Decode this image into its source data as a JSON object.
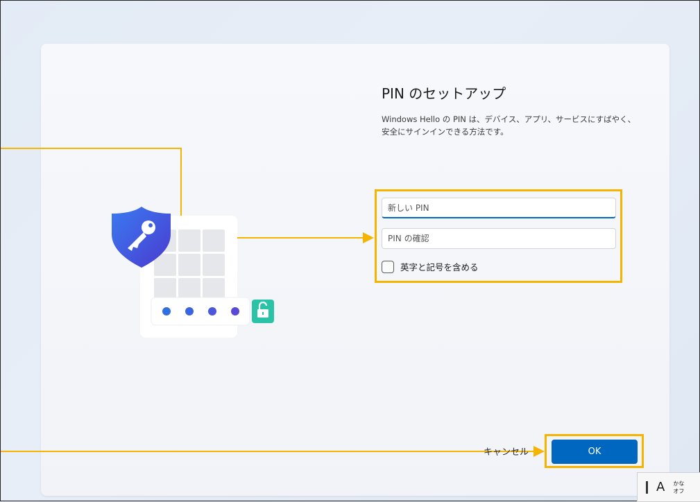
{
  "dialog": {
    "title": "PIN のセットアップ",
    "description": "Windows Hello の PIN は、デバイス、アプリ、サービスにすばやく、安全にサインインできる方法です。"
  },
  "form": {
    "new_pin_placeholder": "新しい PIN",
    "confirm_pin_placeholder": "PIN の確認",
    "include_letters_label": "英字と記号を含める",
    "include_letters_checked": false
  },
  "illustration": {
    "pin_dots": 4,
    "dot_colors": [
      "#2f6fe0",
      "#3a64e0",
      "#4a56dc",
      "#5a48d8"
    ],
    "shield_icon": "key-shield-icon",
    "lock_icon": "unlocked-padlock-icon"
  },
  "actions": {
    "cancel_label": "キャンセル",
    "ok_label": "OK"
  },
  "ime": {
    "mode_label": "A",
    "kana_label": "かな オフ"
  },
  "colors": {
    "accent": "#0067c0",
    "highlight": "#f4b400"
  }
}
